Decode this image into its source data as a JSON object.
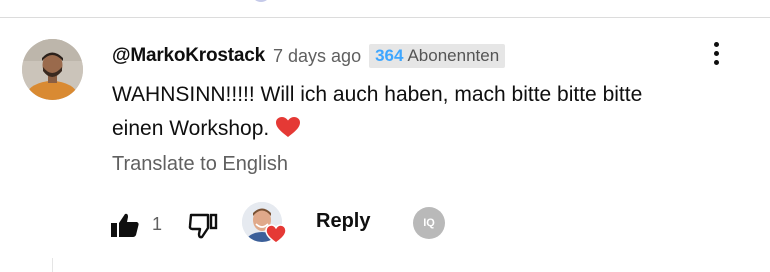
{
  "comment": {
    "author": "@MarkoKrostack",
    "time": "7 days ago",
    "subscriber_badge": {
      "count": "364",
      "label": "Abonennten"
    },
    "text_line1": "WAHNSINN!!!!! Will ich auch haben, mach bitte bitte bitte",
    "text_line2": "einen Workshop.",
    "translate_label": "Translate to English"
  },
  "actions": {
    "like_count": "1",
    "reply_label": "Reply",
    "iq_label": "IQ"
  },
  "icons": {
    "more": "more-vert-icon",
    "like": "thumbs-up-icon",
    "dislike": "thumbs-down-icon",
    "heart": "heart-icon"
  },
  "colors": {
    "subs_count": "#3ea6ff",
    "heart": "#e53935",
    "secondary_text": "#606060"
  }
}
